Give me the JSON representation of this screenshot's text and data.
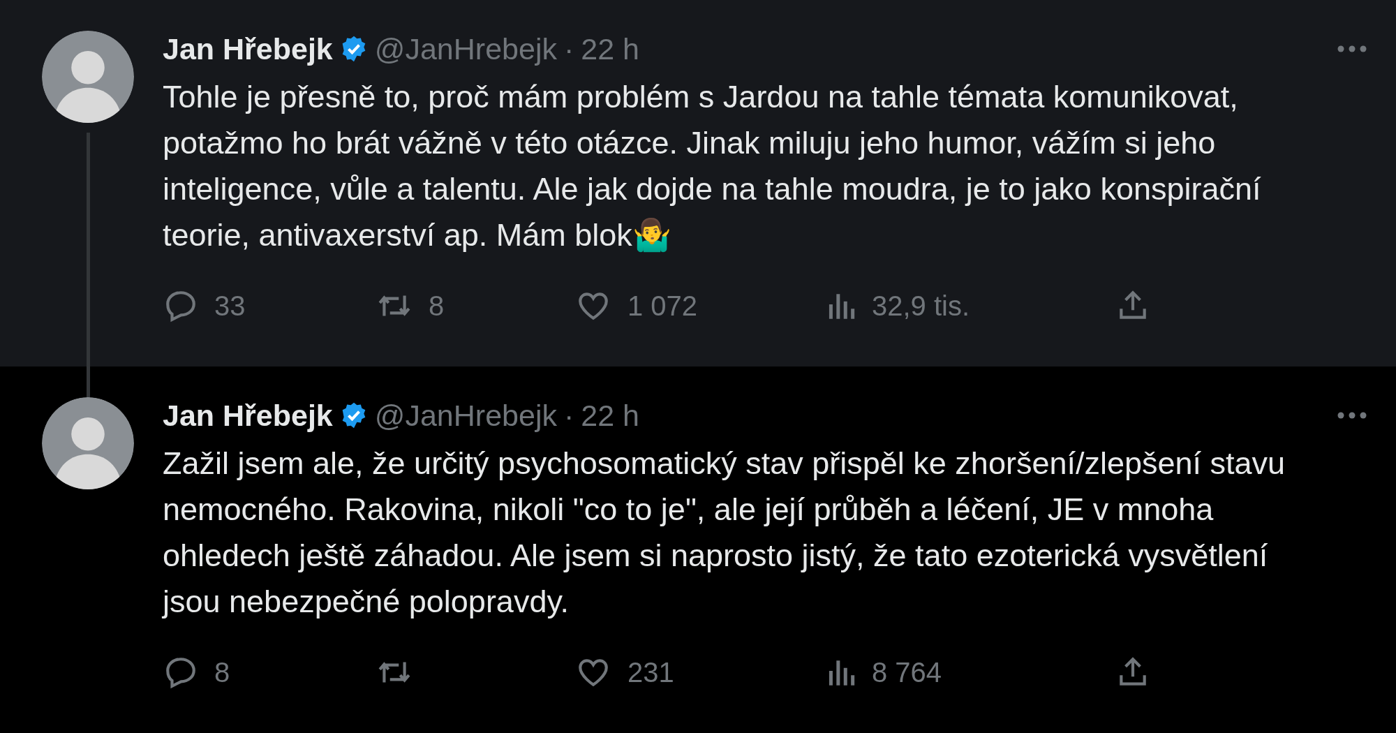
{
  "tweets": [
    {
      "name": "Jan Hřebejk",
      "verified": true,
      "handle": "@JanHrebejk",
      "separator": "·",
      "time": "22 h",
      "thread_line": true,
      "text": "Tohle je přesně to, proč mám problém s Jardou na tahle témata komunikovat, potažmo ho brát vážně v této otázce. Jinak miluju jeho humor, vážím si jeho inteligence, vůle a talentu. Ale jak dojde na tahle moudra, je to jako konspirační teorie, antivaxerství ap. Mám blok🤷‍♂️",
      "replies": "33",
      "reposts": "8",
      "likes": "1 072",
      "views": "32,9 tis."
    },
    {
      "name": "Jan Hřebejk",
      "verified": true,
      "handle": "@JanHrebejk",
      "separator": "·",
      "time": "22 h",
      "thread_line": false,
      "text": "Zažil jsem ale, že určitý psychosomatický stav přispěl ke zhoršení/zlepšení stavu nemocného. Rakovina, nikoli \"co to je\", ale její průběh a léčení, JE v mnoha ohledech ještě záhadou. Ale jsem si naprosto jistý, že tato ezoterická vysvětlení jsou nebezpečné polopravdy.",
      "replies": "8",
      "likes": "231",
      "views": "8 764"
    }
  ]
}
